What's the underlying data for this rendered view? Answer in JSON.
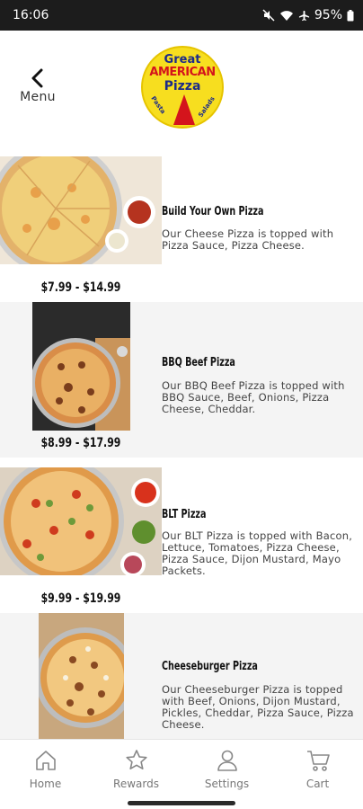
{
  "status_bar": {
    "time": "16:06",
    "battery": "95%"
  },
  "header": {
    "back_label": "Menu"
  },
  "logo": {
    "line1": "Great",
    "line2": "AMERICAN",
    "line3": "Pizza",
    "left_text": "Pasta",
    "right_text": "Salads"
  },
  "menu_items": [
    {
      "name": "Build Your Own Pizza",
      "description": "Our Cheese Pizza is topped with Pizza Sauce, Pizza Cheese.",
      "price": "$7.99 - $14.99"
    },
    {
      "name": "BBQ Beef Pizza",
      "description": "Our BBQ Beef Pizza is topped with BBQ Sauce, Beef, Onions, Pizza Cheese, Cheddar.",
      "price": "$8.99 - $17.99"
    },
    {
      "name": "BLT Pizza",
      "description": "Our BLT Pizza is topped with Bacon, Lettuce, Tomatoes, Pizza Cheese, Pizza Sauce, Dijon Mustard, Mayo Packets.",
      "price": "$9.99 - $19.99"
    },
    {
      "name": "Cheeseburger Pizza",
      "description": "Our Cheeseburger Pizza is topped with Beef, Onions, Dijon Mustard, Pickles, Cheddar, Pizza Sauce, Pizza Cheese."
    }
  ],
  "bottom_nav": [
    {
      "label": "Home",
      "icon": "home-icon"
    },
    {
      "label": "Rewards",
      "icon": "star-icon"
    },
    {
      "label": "Settings",
      "icon": "user-icon"
    },
    {
      "label": "Cart",
      "icon": "cart-icon"
    }
  ],
  "colors": {
    "logo_yellow": "#f7de1f",
    "logo_red": "#d4141c",
    "logo_blue": "#1b2a8a",
    "nav_gray": "#777777",
    "row_shade": "#f4f4f4"
  }
}
